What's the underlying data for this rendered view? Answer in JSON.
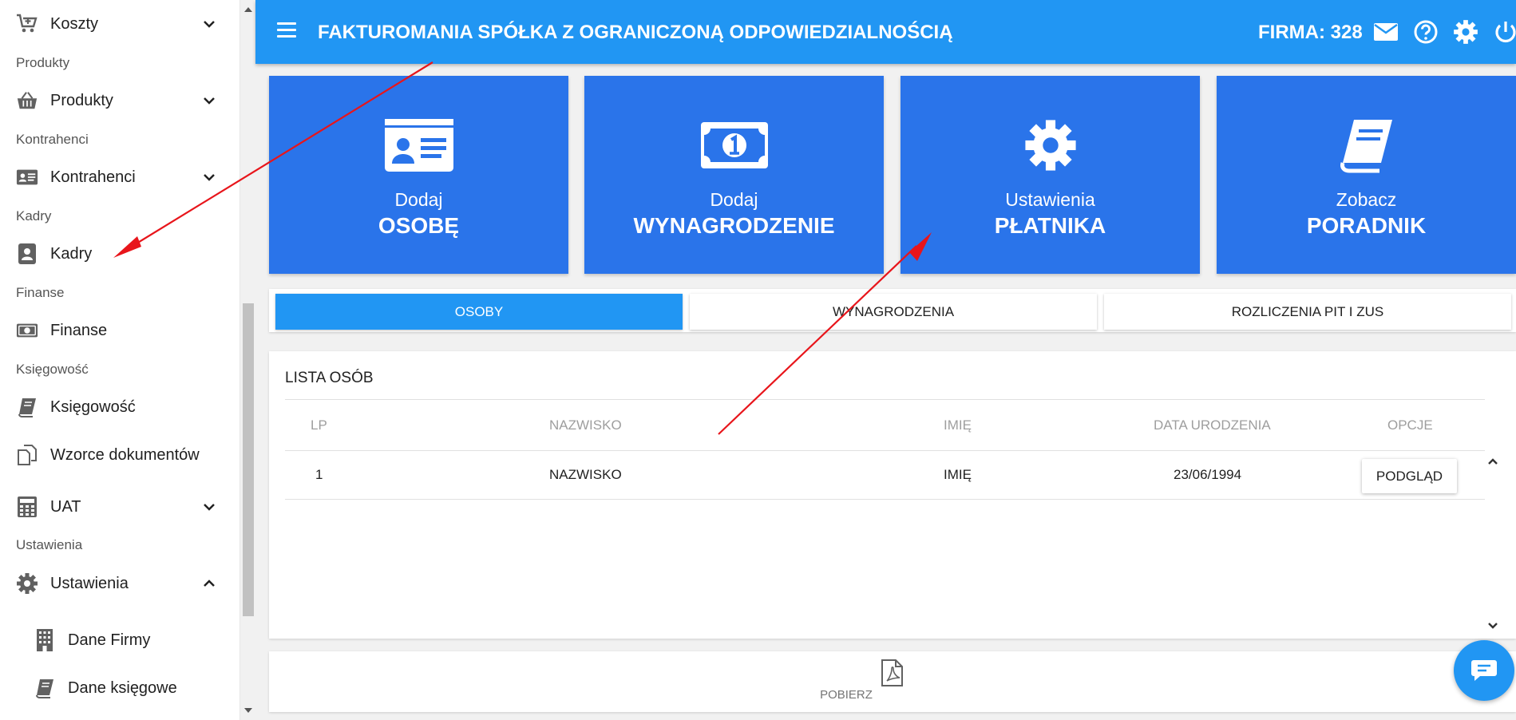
{
  "sidebar": {
    "sections": {
      "produkty": "Produkty",
      "kontrahenci": "Kontrahenci",
      "kadry": "Kadry",
      "finanse": "Finanse",
      "ksiegowosc": "Księgowość",
      "ustawienia": "Ustawienia"
    },
    "items": {
      "koszty": "Koszty",
      "produkty": "Produkty",
      "kontrahenci": "Kontrahenci",
      "kadry": "Kadry",
      "finanse": "Finanse",
      "ksiegowosc": "Księgowość",
      "wzorce": "Wzorce dokumentów",
      "uat": "UAT",
      "ustawienia": "Ustawienia",
      "dane_firmy": "Dane Firmy",
      "dane_ksiegowe": "Dane księgowe"
    }
  },
  "header": {
    "title": "FAKTUROMANIA SPÓŁKA Z OGRANICZONĄ ODPOWIEDZIALNOŚCIĄ",
    "firma": "FIRMA: 328"
  },
  "tiles": [
    {
      "line1": "Dodaj",
      "line2": "OSOBĘ",
      "icon": "id-card-icon"
    },
    {
      "line1": "Dodaj",
      "line2": "WYNAGRODZENIE",
      "icon": "money-bill-icon"
    },
    {
      "line1": "Ustawienia",
      "line2": "PŁATNIKA",
      "icon": "gear-icon"
    },
    {
      "line1": "Zobacz",
      "line2": "PORADNIK",
      "icon": "book-icon"
    }
  ],
  "tabs": {
    "osoby": "OSOBY",
    "wynagrodzenia": "WYNAGRODZENIA",
    "rozliczenia": "ROZLICZENIA PIT I ZUS"
  },
  "list": {
    "title": "LISTA OSÓB",
    "headers": {
      "lp": "LP",
      "nazwisko": "NAZWISKO",
      "imie": "IMIĘ",
      "data": "DATA URODZENIA",
      "opcje": "OPCJE"
    },
    "rows": [
      {
        "lp": "1",
        "nazwisko": "NAZWISKO",
        "imie": "IMIĘ",
        "data": "23/06/1994",
        "action": "PODGLĄD"
      }
    ]
  },
  "download": {
    "label": "POBIERZ"
  },
  "colors": {
    "header": "#2196f3",
    "tile": "#2a74ea",
    "annotation_arrow": "#e8151b"
  }
}
